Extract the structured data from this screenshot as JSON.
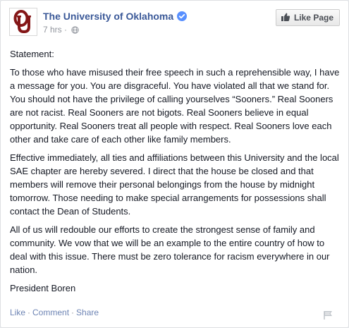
{
  "post": {
    "page_name": "The University of Oklahoma",
    "time": "7 hrs",
    "meta_separator": "·",
    "like_page_label": "Like Page",
    "paragraphs": [
      "Statement:",
      "To those who have misused their free speech in such a reprehensible way, I have a message for you. You are disgraceful. You have violated all that we stand for. You should not have the privilege of calling yourselves “Sooners.” Real Sooners are not racist. Real Sooners are not bigots. Real Sooners believe in equal opportunity. Real Sooners treat all people with respect. Real Sooners love each other and take care of each other like family members.",
      "Effective immediately, all ties and affiliations between this University and the local SAE chapter are hereby severed. I direct that the house be closed and that members will remove their personal belongings from the house by midnight tomorrow. Those needing to make special arrangements for possessions shall contact the Dean of Students.",
      "All of us will redouble our efforts to create the strongest sense of family and community. We vow that we will be an example to the entire country of how to deal with this issue. There must be zero tolerance for racism everywhere in our nation.",
      "President Boren"
    ]
  },
  "actions": {
    "like": "Like",
    "comment": "Comment",
    "share": "Share",
    "separator": "·"
  },
  "icons": {
    "avatar": "ou-logo-icon",
    "verified": "verified-badge-icon",
    "globe": "globe-icon",
    "like": "thumbs-up-icon",
    "flag": "flag-icon"
  },
  "colors": {
    "link_blue": "#3b5998",
    "action_blue": "#6d84b4",
    "verified_blue": "#5890ff",
    "ou_crimson": "#841617",
    "text": "#141823",
    "meta_gray": "#90949c"
  }
}
